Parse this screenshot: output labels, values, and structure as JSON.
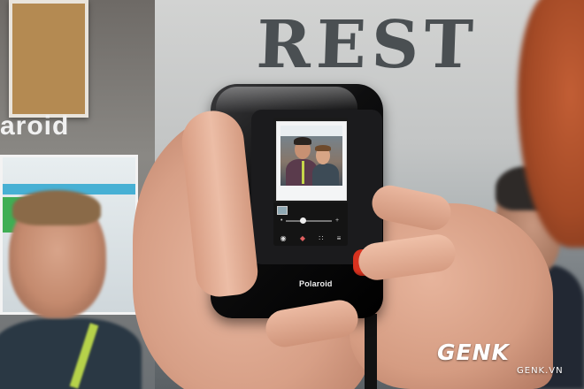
{
  "background": {
    "wall_text": "REST",
    "booth_brand": "aroid"
  },
  "camera": {
    "brand": "Polaroid",
    "accent_color": "#d8321f",
    "screen_icons": [
      "camera-icon",
      "color-palette-icon",
      "grid-icon",
      "menu-icon"
    ]
  },
  "watermark": {
    "logo": "GENK",
    "site": "GENK.VN"
  }
}
